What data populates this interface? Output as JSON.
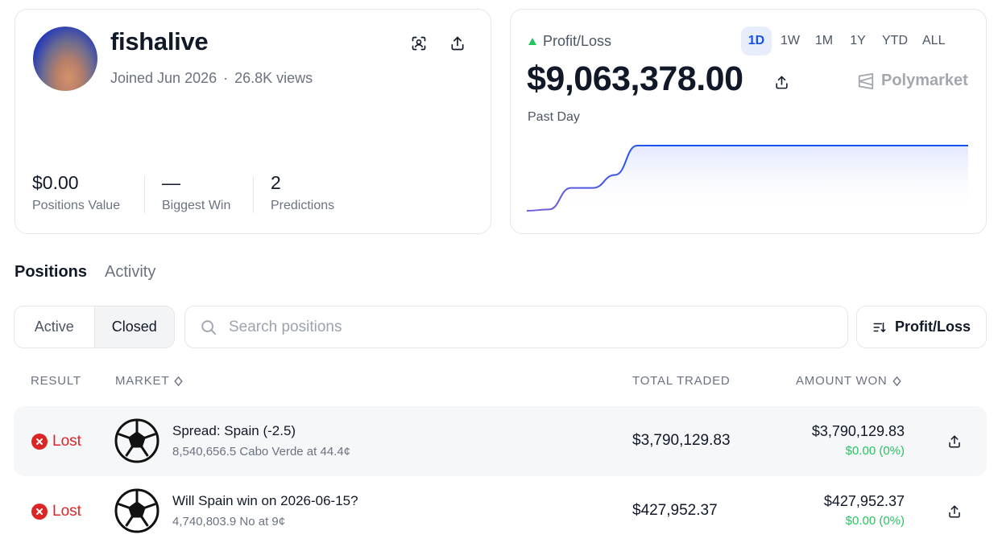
{
  "profile": {
    "username": "fishalive",
    "joined": "Joined Jun 2026",
    "separator": "·",
    "views": "26.8K views",
    "stats": [
      {
        "value": "$0.00",
        "label": "Positions Value"
      },
      {
        "value": "—",
        "label": "Biggest Win"
      },
      {
        "value": "2",
        "label": "Predictions"
      }
    ]
  },
  "pnl": {
    "label": "Profit/Loss",
    "value": "$9,063,378.00",
    "period": "Past Day",
    "brand": "Polymarket",
    "ranges": [
      "1D",
      "1W",
      "1M",
      "1Y",
      "YTD",
      "ALL"
    ],
    "active_range": "1D"
  },
  "chart_data": {
    "type": "area",
    "x": [
      0,
      1,
      2,
      3,
      4,
      5,
      6,
      7,
      8,
      9,
      10,
      11,
      12,
      13,
      14,
      15,
      16,
      17,
      18,
      19,
      20
    ],
    "series": [
      {
        "values": [
          0,
          0.02,
          0.35,
          0.35,
          0.55,
          1,
          1,
          1,
          1,
          1,
          1,
          1,
          1,
          1,
          1,
          1,
          1,
          1,
          1,
          1,
          1
        ]
      }
    ],
    "colors": {
      "line_start": "#7c5ed6",
      "line_end": "#1652f0",
      "fill": "#e3e8fd"
    },
    "grid": false,
    "axes_visible": false
  },
  "tabs": [
    {
      "label": "Positions",
      "active": true
    },
    {
      "label": "Activity",
      "active": false
    }
  ],
  "filter": {
    "active": "Active",
    "closed": "Closed"
  },
  "search": {
    "placeholder": "Search positions"
  },
  "sort": {
    "label": "Profit/Loss"
  },
  "table": {
    "headers": {
      "result": "RESULT",
      "market": "MARKET",
      "total_traded": "TOTAL TRADED",
      "amount_won": "AMOUNT WON"
    },
    "rows": [
      {
        "result": "Lost",
        "title": "Spread: Spain (-2.5)",
        "subtitle": "8,540,656.5 Cabo Verde at 44.4¢",
        "total_traded": "$3,790,129.83",
        "amount": "$3,790,129.83",
        "pnl": "$0.00 (0%)"
      },
      {
        "result": "Lost",
        "title": "Will Spain win on 2026-06-15?",
        "subtitle": "4,740,803.9 No at 9¢",
        "total_traded": "$427,952.37",
        "amount": "$427,952.37",
        "pnl": "$0.00 (0%)"
      }
    ]
  },
  "colors": {
    "accent": "#1652f0",
    "loss": "#dc2626",
    "gain": "#22c55e"
  }
}
